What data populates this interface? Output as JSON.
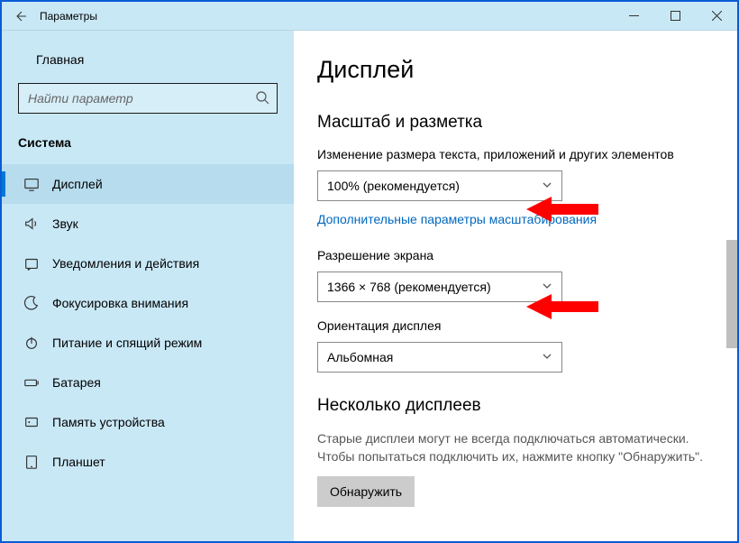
{
  "window": {
    "title": "Параметры"
  },
  "sidebar": {
    "home": "Главная",
    "search_placeholder": "Найти параметр",
    "section": "Система",
    "items": [
      {
        "label": "Дисплей"
      },
      {
        "label": "Звук"
      },
      {
        "label": "Уведомления и действия"
      },
      {
        "label": "Фокусировка внимания"
      },
      {
        "label": "Питание и спящий режим"
      },
      {
        "label": "Батарея"
      },
      {
        "label": "Память устройства"
      },
      {
        "label": "Планшет"
      }
    ]
  },
  "main": {
    "title": "Дисплей",
    "section_scale": "Масштаб и разметка",
    "scale_label": "Изменение размера текста, приложений и других элементов",
    "scale_value": "100% (рекомендуется)",
    "advanced_link": "Дополнительные параметры масштабирования",
    "resolution_label": "Разрешение экрана",
    "resolution_value": "1366 × 768 (рекомендуется)",
    "orientation_label": "Ориентация дисплея",
    "orientation_value": "Альбомная",
    "section_multi": "Несколько дисплеев",
    "multi_note": "Старые дисплеи могут не всегда подключаться автоматически. Чтобы попытаться подключить их, нажмите кнопку \"Обнаружить\".",
    "detect_button": "Обнаружить"
  }
}
